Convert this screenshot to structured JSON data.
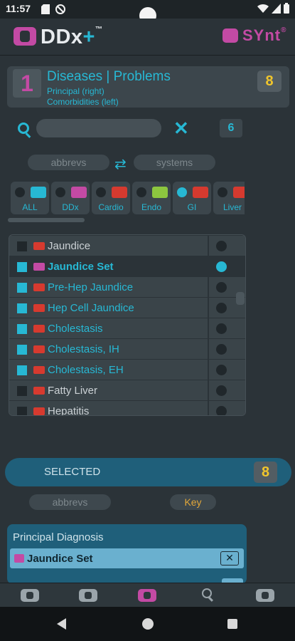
{
  "status_bar": {
    "time": "11:57"
  },
  "app_bar": {
    "logo_text": "DDx",
    "logo_plus": "+",
    "logo_tm": "™",
    "synt_text": "SYnt",
    "synt_reg": "®"
  },
  "diagnosis_card": {
    "number": "1",
    "title": "Diseases | Problems",
    "line1": "Principal (right)",
    "line2": "Comorbidities (left)",
    "count": "8"
  },
  "search": {
    "placeholder": "",
    "value": "",
    "clear_label": "✕",
    "result_count": "6"
  },
  "toggles": {
    "left": "abbrevs",
    "right": "systems"
  },
  "systems": [
    {
      "label": "ALL",
      "selected": false,
      "icon_color": "#27b8d4"
    },
    {
      "label": "DDx",
      "selected": false,
      "icon_color": "#c34aa4"
    },
    {
      "label": "Cardio",
      "selected": false,
      "icon_color": "#d63a2f"
    },
    {
      "label": "Endo",
      "selected": false,
      "icon_color": "#8cc63f"
    },
    {
      "label": "GI",
      "selected": true,
      "icon_color": "#d63a2f"
    },
    {
      "label": "Liver",
      "selected": false,
      "icon_color": "#d63a2f"
    }
  ],
  "diagnoses": [
    {
      "label": "Jaundice",
      "checked": false,
      "principal": false,
      "type": "problem",
      "selected": false
    },
    {
      "label": "Jaundice Set",
      "checked": false,
      "principal": true,
      "type": "set",
      "selected": true
    },
    {
      "label": "Pre-Hep Jaundice",
      "checked": true,
      "principal": false,
      "type": "problem",
      "selected": false
    },
    {
      "label": "Hep Cell Jaundice",
      "checked": true,
      "principal": false,
      "type": "problem",
      "selected": false
    },
    {
      "label": "Cholestasis",
      "checked": true,
      "principal": false,
      "type": "problem",
      "selected": false
    },
    {
      "label": "Cholestasis, IH",
      "checked": true,
      "principal": false,
      "type": "problem",
      "selected": false
    },
    {
      "label": "Cholestasis, EH",
      "checked": true,
      "principal": false,
      "type": "problem",
      "selected": false
    },
    {
      "label": "Fatty Liver",
      "checked": false,
      "principal": false,
      "type": "problem",
      "selected": false
    },
    {
      "label": "Hepatitis",
      "checked": false,
      "principal": false,
      "type": "problem",
      "selected": false
    }
  ],
  "selected_section": {
    "title": "SELECTED",
    "count": "8",
    "abbrevs": "abbrevs",
    "key": "Key"
  },
  "principal_panel": {
    "title": "Principal Diagnosis",
    "item": "Jaundice Set",
    "remove": "✕"
  },
  "colors": {
    "accent": "#27b8d4",
    "brand": "#c34aa4",
    "warning": "#f0c52c",
    "background": "#2b3338"
  }
}
